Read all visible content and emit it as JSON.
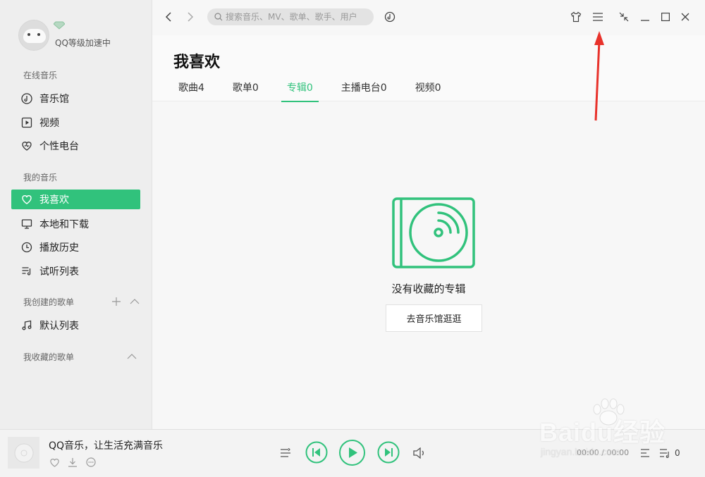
{
  "user": {
    "name": "QQ等级加速中"
  },
  "search": {
    "placeholder": "搜索音乐、MV、歌单、歌手、用户"
  },
  "sidebar": {
    "online_title": "在线音乐",
    "online_items": [
      {
        "label": "音乐馆",
        "icon": "disc-icon"
      },
      {
        "label": "视频",
        "icon": "video-icon"
      },
      {
        "label": "个性电台",
        "icon": "radio-heart-icon"
      }
    ],
    "my_title": "我的音乐",
    "my_items": [
      {
        "label": "我喜欢",
        "icon": "heart-icon",
        "active": true
      },
      {
        "label": "本地和下载",
        "icon": "monitor-icon"
      },
      {
        "label": "播放历史",
        "icon": "clock-icon"
      },
      {
        "label": "试听列表",
        "icon": "playlist-icon"
      }
    ],
    "created_title": "我创建的歌单",
    "created_items": [
      {
        "label": "默认列表",
        "icon": "music-note-icon"
      }
    ],
    "collected_title": "我收藏的歌单"
  },
  "main": {
    "title": "我喜欢",
    "tabs": [
      {
        "label": "歌曲4",
        "active": false
      },
      {
        "label": "歌单0",
        "active": false
      },
      {
        "label": "专辑0",
        "active": true
      },
      {
        "label": "主播电台0",
        "active": false
      },
      {
        "label": "视频0",
        "active": false
      }
    ],
    "empty_text": "没有收藏的专辑",
    "empty_button": "去音乐馆逛逛"
  },
  "player": {
    "song_title": "QQ音乐，让生活充满音乐",
    "time": "00:00 / 00:00",
    "playlist_count": "0"
  },
  "colors": {
    "accent": "#31c27c",
    "annotation": "#e8322b"
  },
  "watermark": {
    "brand": "Baidu经验",
    "url": "jingyan.baidu.com"
  }
}
